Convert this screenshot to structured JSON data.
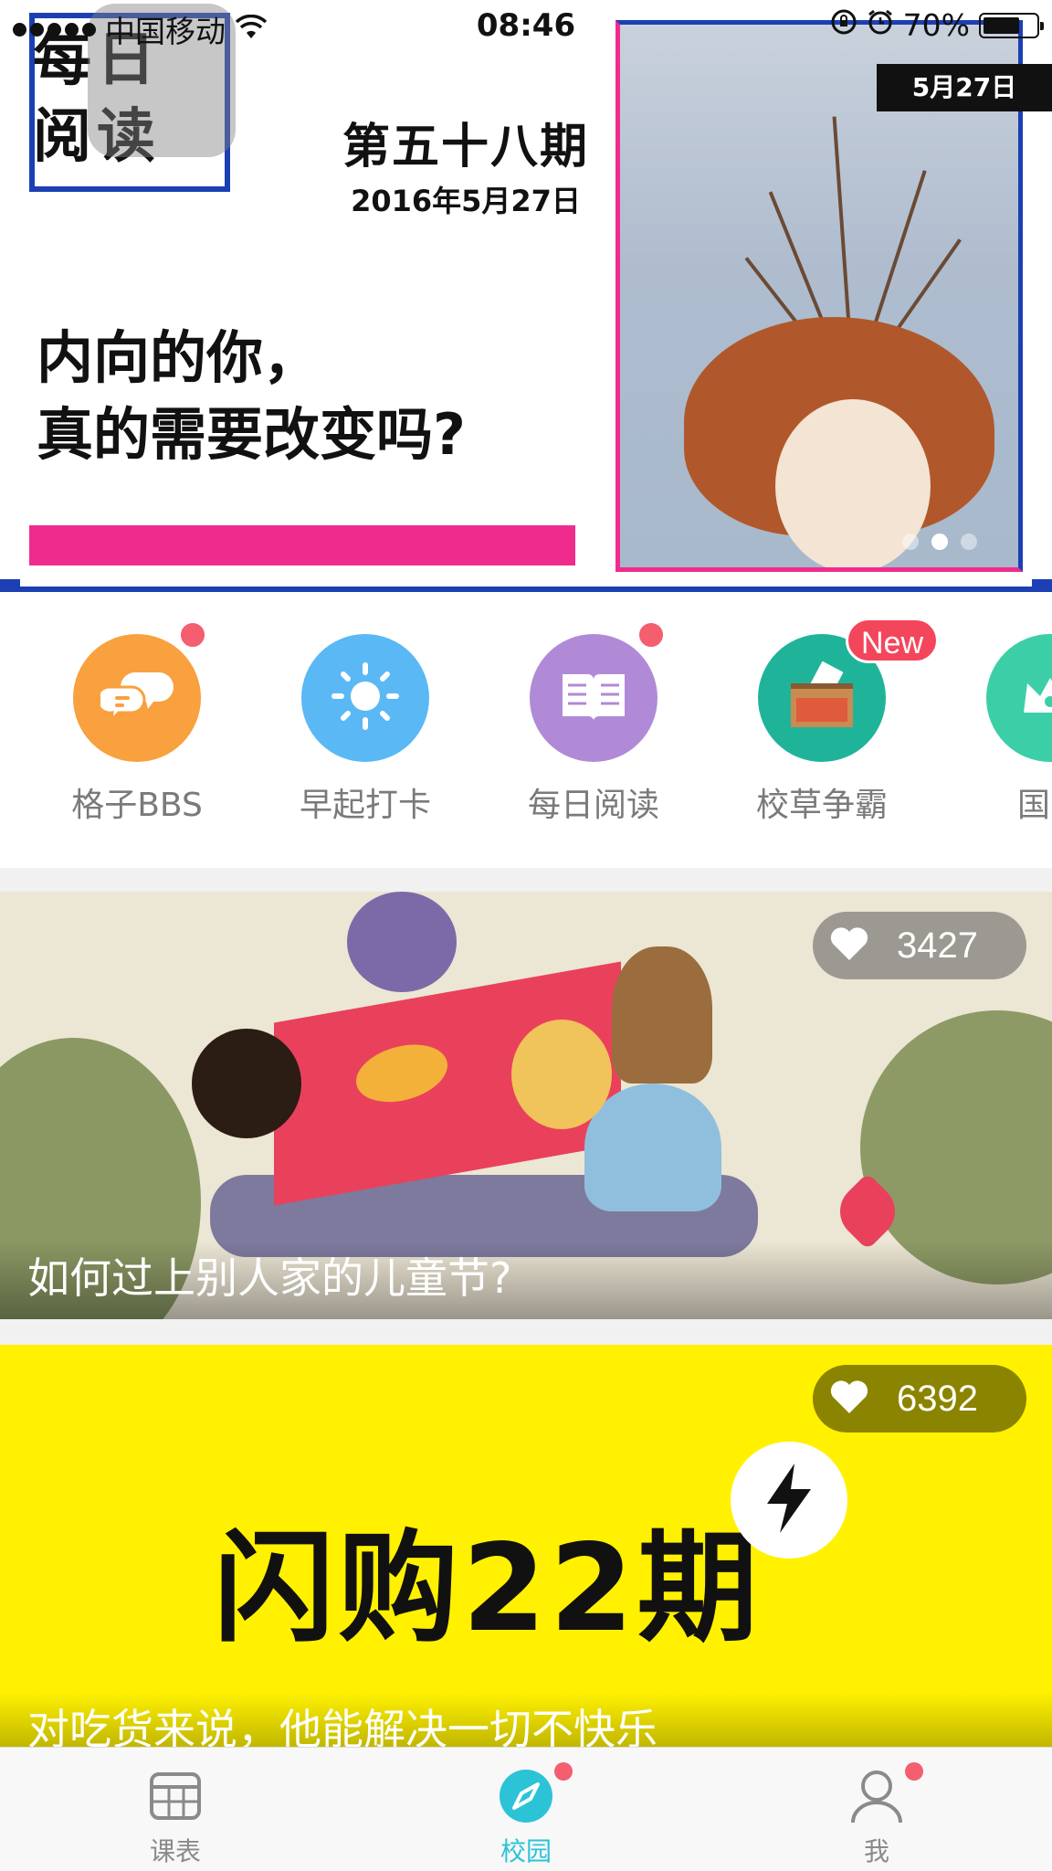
{
  "status_bar": {
    "carrier": "中国移动",
    "time": "08:46",
    "battery_percent": "70%",
    "battery_level": 0.7,
    "icons": [
      "signal-dots-icon",
      "wifi-icon",
      "rotation-lock-icon",
      "alarm-icon",
      "battery-icon"
    ]
  },
  "banner": {
    "logo_text": "每日\n阅读",
    "issue_title": "第五十八期",
    "issue_date": "2016年5月27日",
    "headline_line1": "内向的你，",
    "headline_line2": "真的需要改变吗?",
    "date_badge": "5月27日",
    "page_count": 3,
    "active_page": 2,
    "colors": {
      "frame_blue": "#1c3fb3",
      "accent_pink": "#ef2c8d"
    }
  },
  "features": [
    {
      "label": "格子BBS",
      "icon": "chat-bubbles-icon",
      "color": "#f9a03f",
      "red_dot": true
    },
    {
      "label": "早起打卡",
      "icon": "sun-icon",
      "color": "#5ab8f5",
      "red_dot": false
    },
    {
      "label": "每日阅读",
      "icon": "book-icon",
      "color": "#b08ad6",
      "red_dot": true
    },
    {
      "label": "校草争霸",
      "icon": "vote-box-icon",
      "color": "#1fb49a",
      "badge": "New"
    },
    {
      "label": "国民",
      "icon": "crown-icon",
      "color": "#3ccfa7",
      "red_dot": false
    }
  ],
  "cards": [
    {
      "title": "如何过上别人家的儿童节?",
      "likes": "3427",
      "icon": "heart-icon"
    },
    {
      "title": "对吃货来说，他能解决一切不快乐",
      "likes": "6392",
      "icon": "heart-icon",
      "banner_text": "闪购22期",
      "badge_icon": "lightning-icon"
    }
  ],
  "tabbar": {
    "tabs": [
      {
        "label": "课表",
        "icon": "timetable-icon",
        "active": false,
        "dot": false
      },
      {
        "label": "校园",
        "icon": "compass-icon",
        "active": true,
        "dot": true
      },
      {
        "label": "我",
        "icon": "person-icon",
        "active": false,
        "dot": true
      }
    ],
    "active_color": "#2cc3d6"
  }
}
